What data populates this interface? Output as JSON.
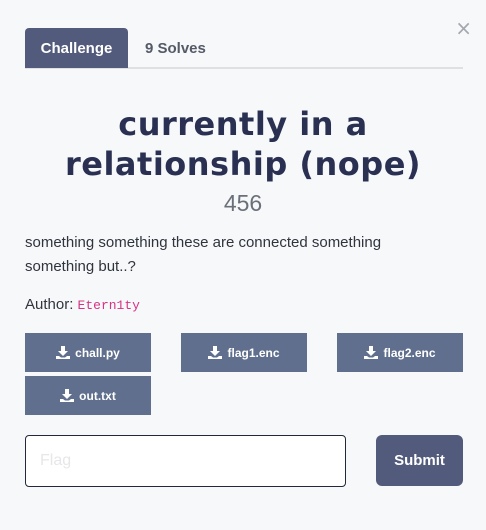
{
  "modal": {
    "close_glyph": "×"
  },
  "tabs": [
    {
      "label": "Challenge",
      "active": true
    },
    {
      "label": "9 Solves",
      "active": false
    }
  ],
  "challenge": {
    "title_line1": "currently in a",
    "title_line2": "relationship (nope)",
    "value": "456",
    "description_line1": "something something these are connected something",
    "description_line2": "something but..?",
    "author_label": "Author:",
    "author_name": "Etern1ty"
  },
  "files": [
    {
      "name": "chall.py",
      "icon": "download-icon"
    },
    {
      "name": "flag1.enc",
      "icon": "download-icon"
    },
    {
      "name": "flag2.enc",
      "icon": "download-icon"
    },
    {
      "name": "out.txt",
      "icon": "download-icon"
    }
  ],
  "submission": {
    "placeholder": "Flag",
    "value": "",
    "submit_label": "Submit"
  },
  "colors": {
    "primary": "#535b7c",
    "file_button": "#5f6f8d",
    "title": "#2a3052",
    "author_code": "#d63384"
  }
}
